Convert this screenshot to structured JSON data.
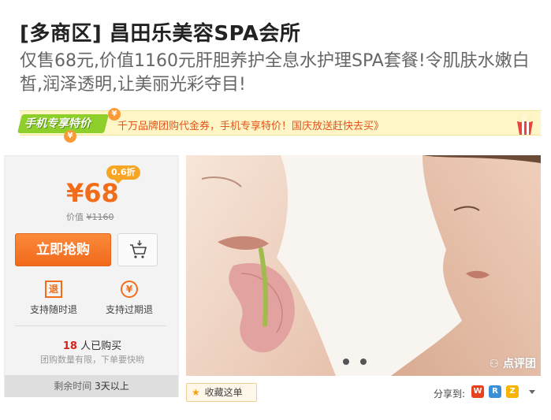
{
  "header": {
    "title": "[多商区] 昌田乐美容SPA会所",
    "subtitle": "仅售68元,价值1160元肝胆养护全息水护理SPA套餐!令肌肤水嫩白皙,润泽透明,让美丽光彩夺目!"
  },
  "promo": {
    "badge": "手机专享特价",
    "text": "千万品牌团购代金券，手机专享特价！国庆放送赶快去买》"
  },
  "buy": {
    "discount": "0.6折",
    "price": "¥68",
    "original_label": "价值",
    "original_price": "¥1160",
    "buy_label": "立即抢购",
    "feature1_icon_char": "退",
    "feature1": "支持随时退",
    "feature2_icon_char": "¥",
    "feature2": "支持过期退",
    "bought_count": "18",
    "bought_label": "人已购买",
    "limit_note": "团购数量有限，下单要快哟",
    "remain_label": "剩余时间",
    "remain_value": "3天以上"
  },
  "gallery": {
    "watermark": "点评团",
    "dots": 2
  },
  "actions": {
    "favorite_label": "收藏这单",
    "share_label": "分享到:"
  },
  "colors": {
    "accent": "#f26d1a",
    "promo_bg": "#fff6c8",
    "promo_green": "#8fcf2c"
  }
}
